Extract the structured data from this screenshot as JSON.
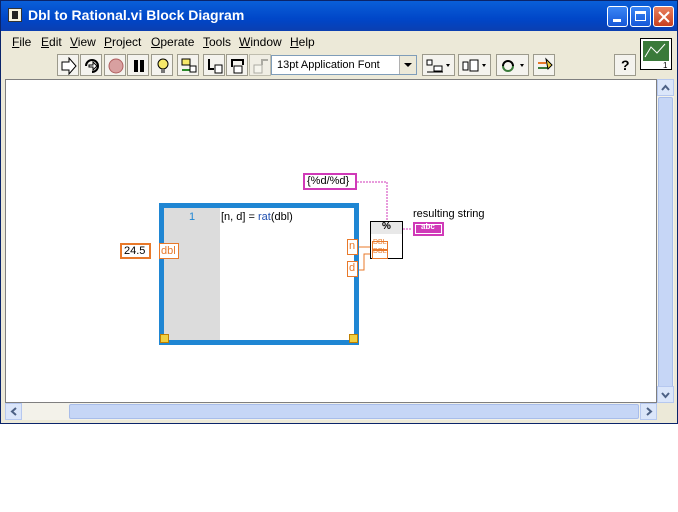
{
  "window": {
    "title": "Dbl to Rational.vi Block Diagram"
  },
  "menu": [
    {
      "label": "File",
      "key": "F",
      "rest": "ile"
    },
    {
      "label": "Edit",
      "key": "E",
      "rest": "dit"
    },
    {
      "label": "View",
      "key": "V",
      "rest": "iew"
    },
    {
      "label": "Project",
      "key": "P",
      "rest": "roject"
    },
    {
      "label": "Operate",
      "key": "O",
      "rest": "perate"
    },
    {
      "label": "Tools",
      "key": "T",
      "rest": "ools"
    },
    {
      "label": "Window",
      "key": "W",
      "rest": "indow"
    },
    {
      "label": "Help",
      "key": "H",
      "rest": "elp"
    }
  ],
  "toolbar": {
    "buttons": [
      "run-arrow-icon",
      "run-continuous-icon",
      "abort-icon",
      "pause-icon",
      "highlight-execution-icon",
      "retain-wire-values-icon",
      "step-into-icon",
      "step-over-icon",
      "step-out-icon"
    ],
    "font": "13pt Application Font",
    "help": "?"
  },
  "diagram": {
    "constant_value": "24.5",
    "indicator_dbl": "dbl",
    "format_string": "{%d/%d}",
    "output_label": "resulting string",
    "mathscript": {
      "line_number": "1",
      "code_prefix": "[n, d] = ",
      "code_fn": "rat",
      "code_suffix": "(dbl)"
    },
    "out_n": "n",
    "out_d": "d",
    "fmt_node_label": "%",
    "indicator_abc": "abc",
    "dbl_tag": "DBL"
  },
  "colors": {
    "orange": "#e8792a",
    "pink": "#d03ab8",
    "blue": "#1f86d3",
    "title": "#0a5fd8"
  }
}
